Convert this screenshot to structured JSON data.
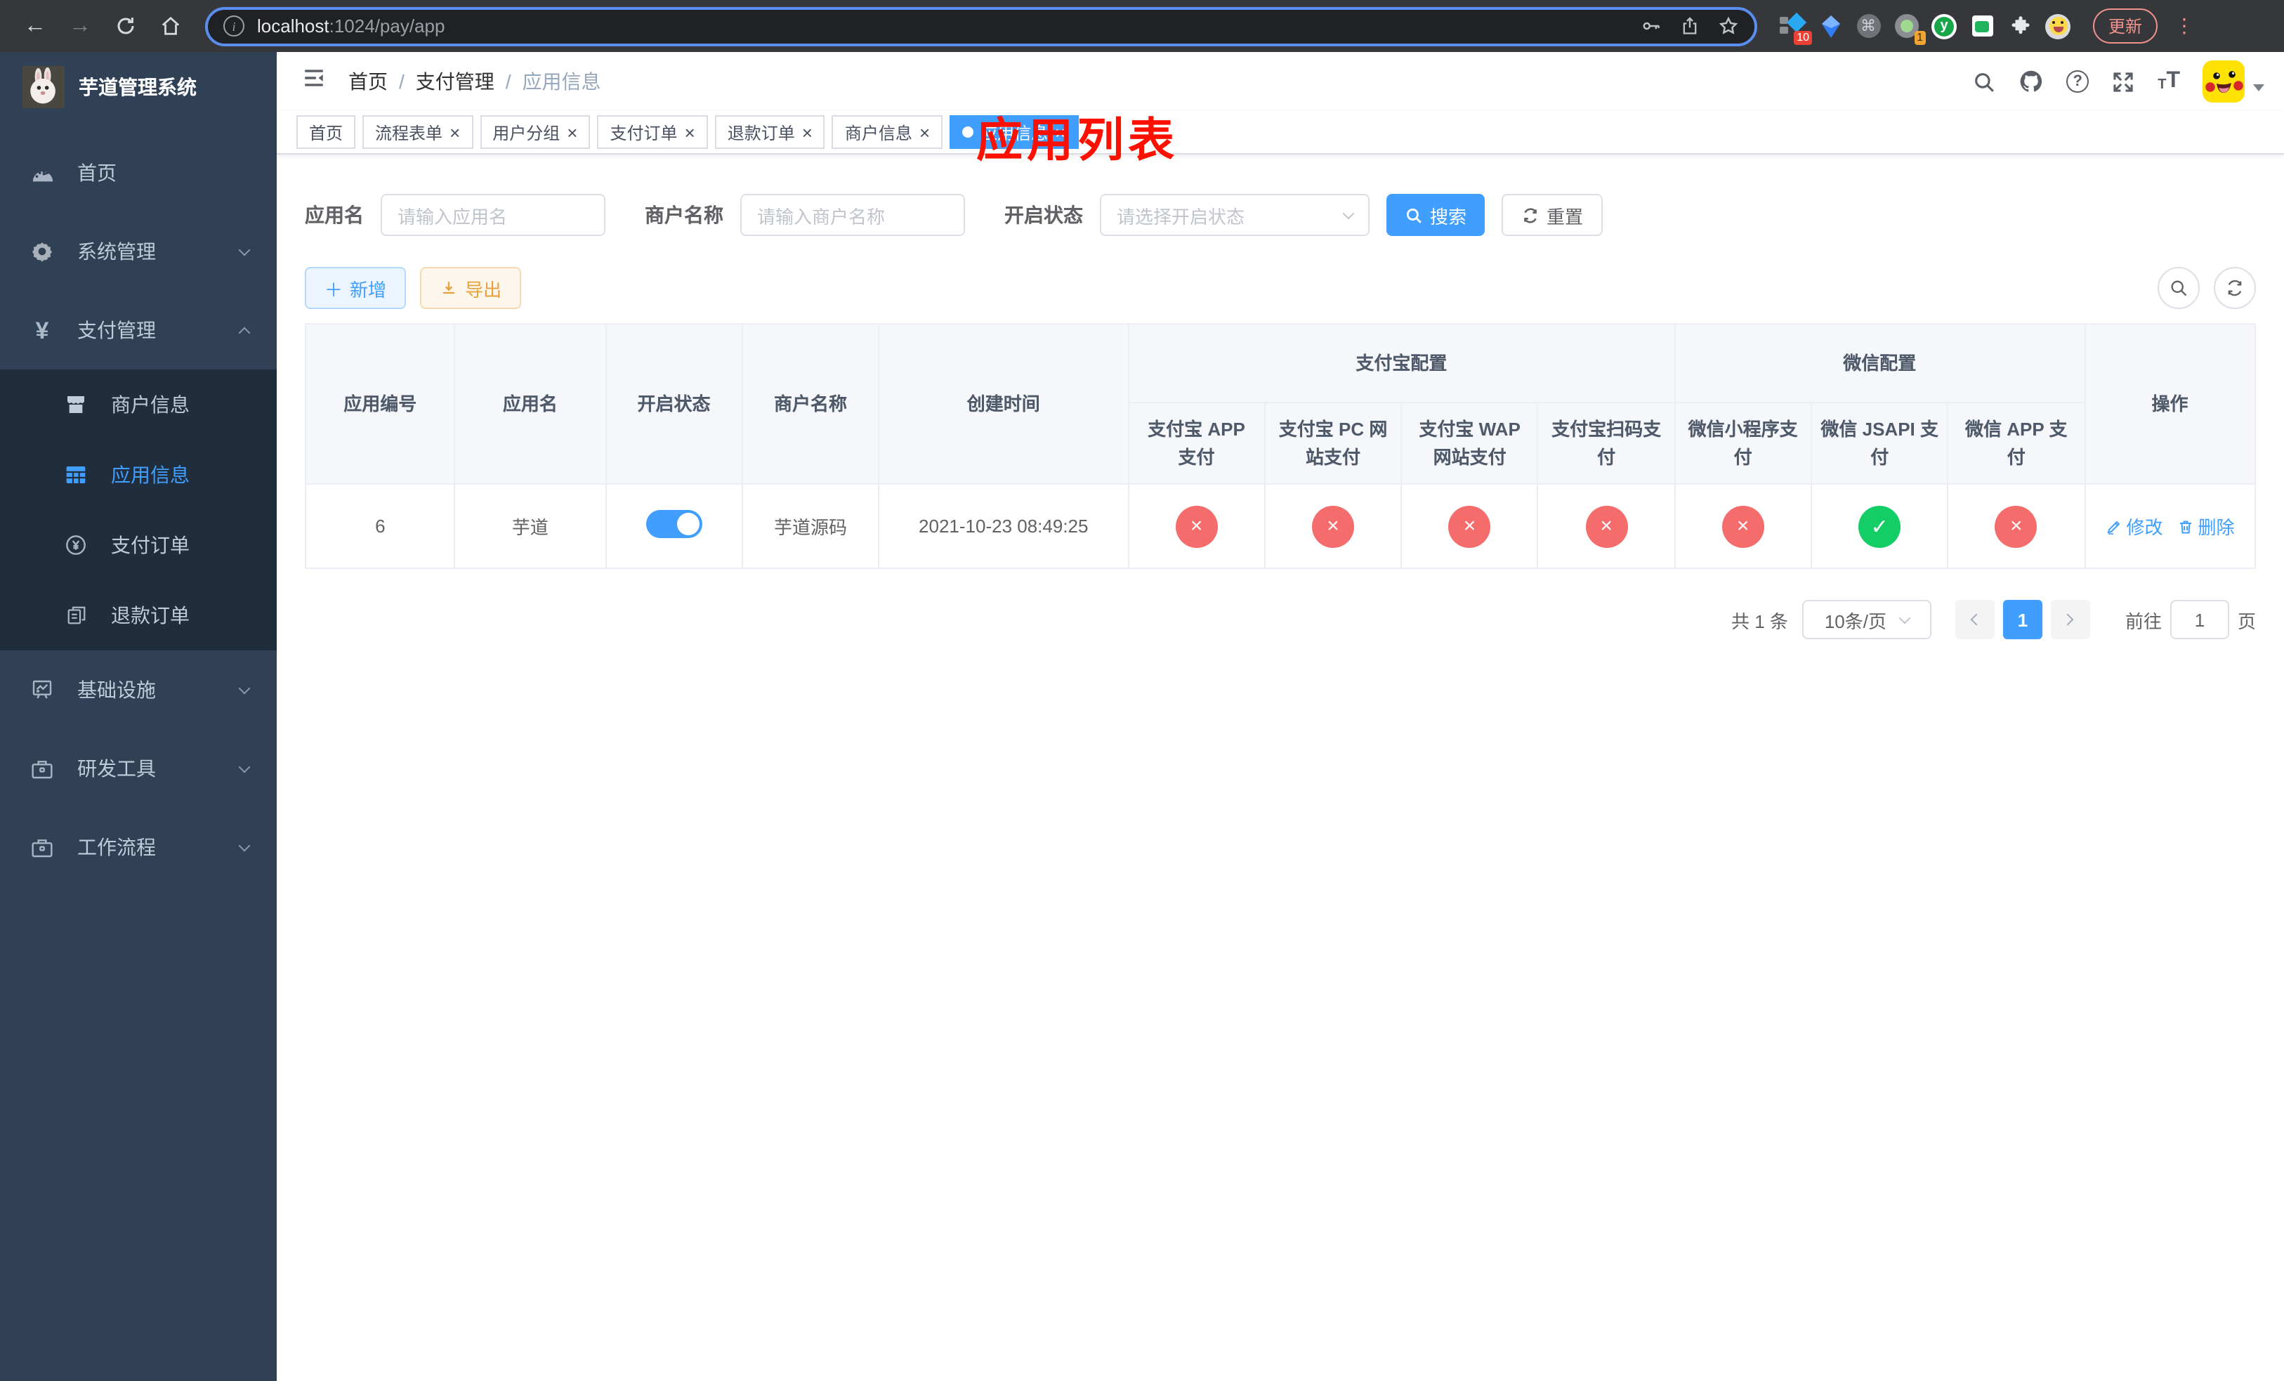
{
  "browser": {
    "url_host": "localhost",
    "url_rest": ":1024/pay/app",
    "ext_badge_blue_diamond": "10",
    "ext_badge_gray_ball": "1",
    "ext_y_letter": "y",
    "update_label": "更新"
  },
  "colors": {
    "primary": "#409eff",
    "success": "#13ce66",
    "danger": "#f56c6c",
    "warning": "#e6a23c",
    "annotation_red": "#fe1000",
    "sidebar_bg": "#304156",
    "submenu_bg": "#1f2d3d"
  },
  "sidebar": {
    "app_title": "芋道管理系统",
    "menu": [
      {
        "label": "首页"
      },
      {
        "label": "系统管理"
      },
      {
        "label": "支付管理"
      },
      {
        "label": "基础设施"
      },
      {
        "label": "研发工具"
      },
      {
        "label": "工作流程"
      }
    ],
    "submenu": [
      {
        "label": "商户信息"
      },
      {
        "label": "应用信息"
      },
      {
        "label": "支付订单"
      },
      {
        "label": "退款订单"
      }
    ]
  },
  "header": {
    "breadcrumb": [
      "首页",
      "支付管理",
      "应用信息"
    ],
    "annotation": "应用列表"
  },
  "tabs": [
    {
      "label": "首页"
    },
    {
      "label": "流程表单"
    },
    {
      "label": "用户分组"
    },
    {
      "label": "支付订单"
    },
    {
      "label": "退款订单"
    },
    {
      "label": "商户信息"
    },
    {
      "label": "应用信息"
    }
  ],
  "filters": {
    "app_name_label": "应用名",
    "app_name_placeholder": "请输入应用名",
    "merchant_label": "商户名称",
    "merchant_placeholder": "请输入商户名称",
    "status_label": "开启状态",
    "status_placeholder": "请选择开启状态",
    "search_label": "搜索",
    "reset_label": "重置"
  },
  "toolbar": {
    "add_label": "新增",
    "export_label": "导出"
  },
  "table": {
    "group_headers": {
      "alipay": "支付宝配置",
      "wechat": "微信配置"
    },
    "columns": {
      "app_id": "应用编号",
      "app_name": "应用名",
      "enabled": "开启状态",
      "merchant": "商户名称",
      "created": "创建时间",
      "actions": "操作"
    },
    "sub_columns": [
      "支付宝 APP 支付",
      "支付宝 PC 网站支付",
      "支付宝 WAP 网站支付",
      "支付宝扫码支付",
      "微信小程序支付",
      "微信 JSAPI 支付",
      "微信 APP 支付"
    ],
    "row": {
      "app_id": "6",
      "app_name": "芋道",
      "enabled": true,
      "merchant": "芋道源码",
      "created": "2021-10-23 08:49:25",
      "statuses": [
        false,
        false,
        false,
        false,
        false,
        true,
        false
      ],
      "edit_label": "修改",
      "delete_label": "删除"
    }
  },
  "pagination": {
    "total": "共 1 条",
    "page_size": "10条/页",
    "current_page": "1",
    "goto_prefix": "前往",
    "goto_value": "1",
    "goto_suffix": "页"
  }
}
